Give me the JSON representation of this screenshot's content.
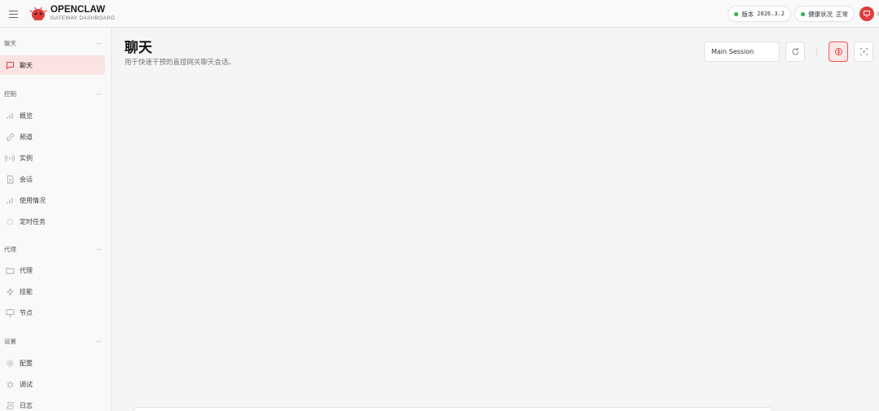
{
  "brand": {
    "title": "OPENCLAW",
    "subtitle": "GATEWAY DASHBOARD"
  },
  "topbar": {
    "version_label": "版本",
    "version_value": "2026.3.2",
    "health_label": "健康状况",
    "health_value": "正常",
    "status_color": "#2bb34b",
    "accent_color": "#e33b3b"
  },
  "sidebar": {
    "sections": [
      {
        "title": "聊天",
        "items": [
          {
            "label": "聊天",
            "icon": "message-square-icon",
            "active": true
          }
        ]
      },
      {
        "title": "控制",
        "items": [
          {
            "label": "概览",
            "icon": "bar-chart-icon"
          },
          {
            "label": "频道",
            "icon": "link-icon"
          },
          {
            "label": "实例",
            "icon": "radio-icon"
          },
          {
            "label": "会话",
            "icon": "file-text-icon"
          },
          {
            "label": "使用情况",
            "icon": "bar-chart-icon"
          },
          {
            "label": "定时任务",
            "icon": "loader-icon"
          }
        ]
      },
      {
        "title": "代理",
        "items": [
          {
            "label": "代理",
            "icon": "folder-icon"
          },
          {
            "label": "技能",
            "icon": "zap-icon"
          },
          {
            "label": "节点",
            "icon": "monitor-icon"
          }
        ]
      },
      {
        "title": "设置",
        "items": [
          {
            "label": "配置",
            "icon": "gear-icon"
          },
          {
            "label": "调试",
            "icon": "bug-icon"
          },
          {
            "label": "日志",
            "icon": "scroll-icon"
          }
        ]
      }
    ]
  },
  "main": {
    "title": "聊天",
    "subtitle": "用于快速干预的直接网关聊天会话。",
    "session_value": "Main Session"
  }
}
